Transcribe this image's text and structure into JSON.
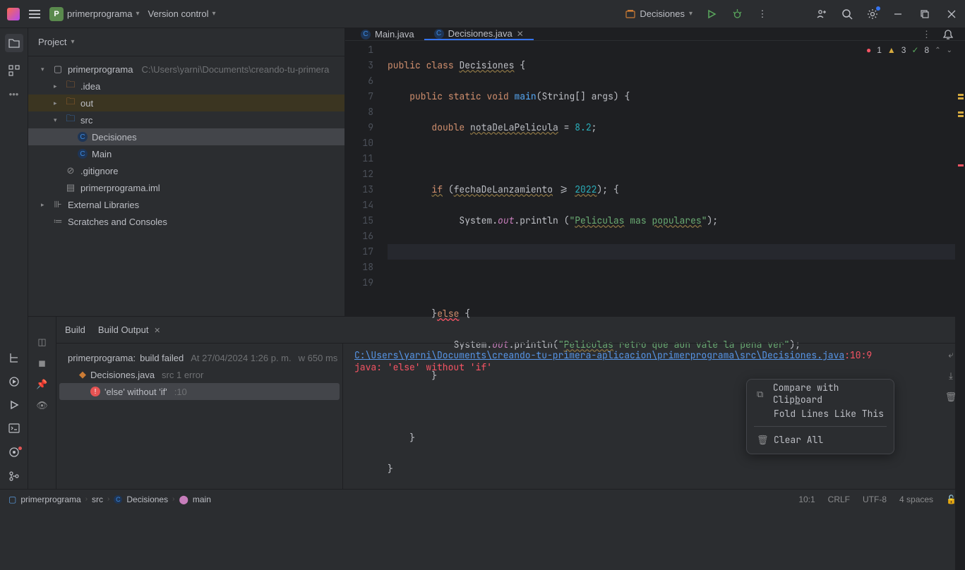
{
  "titlebar": {
    "project": "primerprograma",
    "vcs": "Version control",
    "runConfig": "Decisiones"
  },
  "projectPanel": {
    "title": "Project",
    "root": "primerprograma",
    "rootPath": "C:\\Users\\yarni\\Documents\\creando-tu-primera",
    "idea": ".idea",
    "out": "out",
    "src": "src",
    "decisiones": "Decisiones",
    "main": "Main",
    "gitignore": ".gitignore",
    "iml": "primerprograma.iml",
    "extLib": "External Libraries",
    "scratches": "Scratches and Consoles"
  },
  "tabs": {
    "main": "Main.java",
    "decisiones": "Decisiones.java"
  },
  "inspections": {
    "errors": "1",
    "warnings": "3",
    "typos": "8"
  },
  "code": {
    "l1a": "public",
    "l1b": "class",
    "l1c": "Decisiones",
    "l1d": " {",
    "l3a": "public",
    "l3b": "static",
    "l3c": "void",
    "l3d": "main",
    "l3e": "(String[] args) {",
    "l6a": "double",
    "l6b": "notaDeLaPelicula",
    "l6c": " = ",
    "l6d": "8.2",
    "l6e": ";",
    "l8a": "if",
    "l8b": " (",
    "l8c": "fechaDeLanzamiento",
    "l8d": " >= ",
    "l8e": "2022",
    "l8f": "); {",
    "l9a": "System.",
    "l9b": "out",
    "l9c": ".println (",
    "l9d": "\"",
    "l9e": "Peliculas",
    "l9f": " mas ",
    "l9g": "populares",
    "l9h": "\"",
    "l9i": ");",
    "l12a": "}",
    "l12b": "else",
    "l12c": " {",
    "l13a": "System.",
    "l13b": "out",
    "l13c": ".println(",
    "l13d": "\"",
    "l13e": "Peliculas",
    "l13f": " retro que aun vale la pena ver",
    "l13g": "\"",
    "l13h": ");",
    "l14": "}",
    "l16": "}",
    "l17": "}"
  },
  "gutter": [
    "1",
    "3",
    "6",
    "7",
    "8",
    "9",
    "10",
    "11",
    "12",
    "13",
    "14",
    "15",
    "16",
    "17",
    "18",
    "19"
  ],
  "build": {
    "tabBuild": "Build",
    "tabOutput": "Build Output",
    "root": "primerprograma:",
    "rootStatus": "build failed",
    "rootTime": "At 27/04/2024 1:26 p. m.",
    "rootExtra": "w 650 ms",
    "file": "Decisiones.java",
    "fileSub": "src 1 error",
    "error": "'else' without 'if'",
    "errorLine": ":10",
    "outLink": "C:\\Users\\yarni\\Documents\\creando-tu-primera-aplicacion\\primerprograma\\src\\Decisiones.java",
    "outLoc": ":10:9",
    "outErr": "java: 'else' without 'if'"
  },
  "contextMenu": {
    "compare1": "Compare with Clip",
    "compare2": "b",
    "compare3": "oard",
    "fold": "Fold Lines Like This",
    "clear": "Clear All"
  },
  "statusbar": {
    "p1": "primerprograma",
    "p2": "src",
    "p3": "Decisiones",
    "p4": "main",
    "pos": "10:1",
    "eol": "CRLF",
    "enc": "UTF-8",
    "indent": "4 spaces"
  }
}
